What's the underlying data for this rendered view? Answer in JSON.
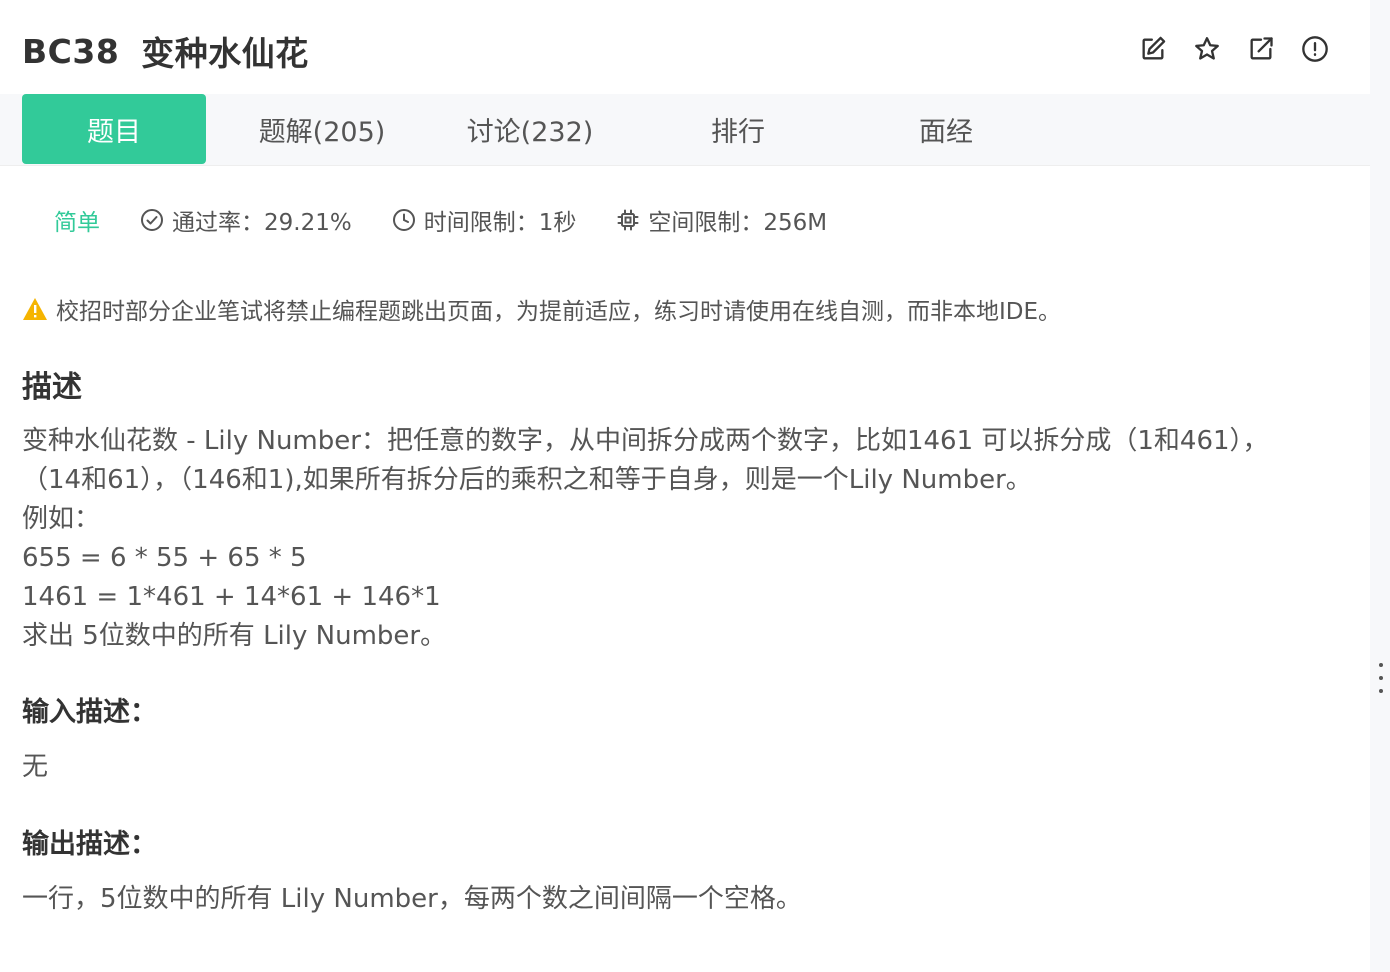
{
  "problem": {
    "id": "BC38",
    "name": "变种水仙花"
  },
  "header_actions": [
    {
      "icon": "edit-icon"
    },
    {
      "icon": "star-icon"
    },
    {
      "icon": "share-icon"
    },
    {
      "icon": "report-icon"
    }
  ],
  "tabs": [
    {
      "label": "题目",
      "active": true
    },
    {
      "label": "题解(205)",
      "active": false
    },
    {
      "label": "讨论(232)",
      "active": false
    },
    {
      "label": "排行",
      "active": false
    },
    {
      "label": "面经",
      "active": false
    }
  ],
  "meta": {
    "difficulty": "简单",
    "pass_rate": "通过率：29.21%",
    "time_limit": "时间限制：1秒",
    "space_limit": "空间限制：256M"
  },
  "warning": "校招时部分企业笔试将禁止编程题跳出页面，为提前适应，练习时请使用在线自测，而非本地IDE。",
  "description": {
    "title": "描述",
    "lines": [
      "变种水仙花数 - Lily Number：把任意的数字，从中间拆分成两个数字，比如1461 可以拆分成（1和461），",
      "（14和61），（146和1),如果所有拆分后的乘积之和等于自身，则是一个Lily Number。",
      "例如：",
      "655 = 6 * 55 + 65 * 5",
      "1461 = 1*461 + 14*61 + 146*1",
      "求出 5位数中的所有 Lily Number。"
    ]
  },
  "input": {
    "title": "输入描述：",
    "body": "无"
  },
  "output": {
    "title": "输出描述：",
    "body": "一行，5位数中的所有 Lily Number，每两个数之间间隔一个空格。"
  },
  "colors": {
    "accent": "#32ca99",
    "warning": "#f5b400",
    "tab_bar": "#f7f8fa",
    "text": "#333333",
    "muted": "#555555"
  }
}
